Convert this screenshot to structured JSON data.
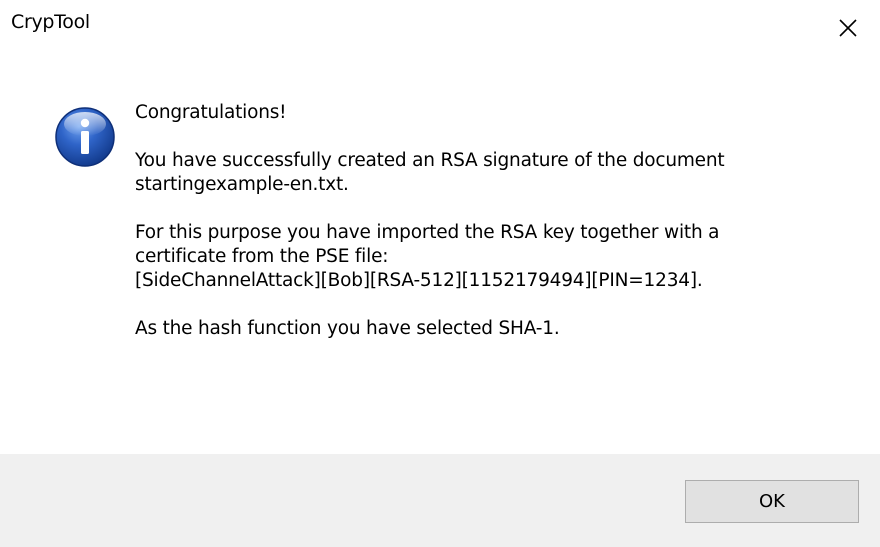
{
  "window": {
    "title": "CrypTool",
    "close_icon": "close-icon"
  },
  "message": {
    "icon": "info-icon",
    "heading": "Congratulations!",
    "paragraphs": [
      {
        "lines": [
          "You have successfully created an RSA signature of the document",
          "startingexample-en.txt."
        ]
      },
      {
        "lines": [
          "For this purpose you have imported the RSA key together with a",
          "certificate from the PSE file:",
          "[SideChannelAttack][Bob][RSA-512][1152179494][PIN=1234]."
        ]
      },
      {
        "lines": [
          "As the hash function you have selected SHA-1."
        ]
      }
    ]
  },
  "buttons": {
    "ok_label": "OK"
  },
  "colors": {
    "footer_background": "#f0f0f0",
    "icon_blue": "#1d4ea8",
    "button_background": "#e1e1e1",
    "button_border": "#adadad"
  }
}
